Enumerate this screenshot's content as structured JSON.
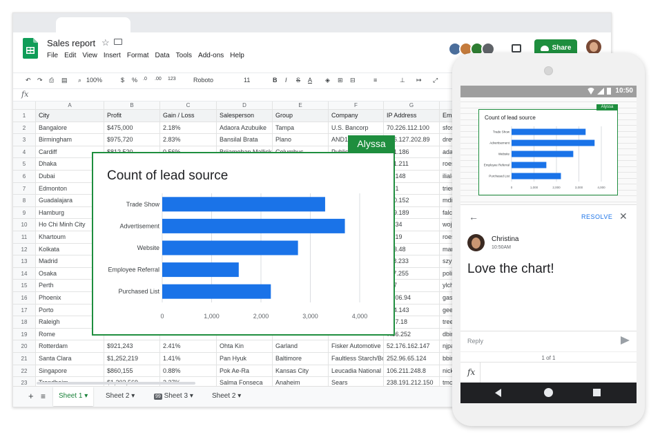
{
  "doc": {
    "title": "Sales report"
  },
  "menu": [
    "File",
    "Edit",
    "View",
    "Insert",
    "Format",
    "Data",
    "Tools",
    "Add-ons",
    "Help"
  ],
  "share_label": "Share",
  "toolbar": {
    "zoom": "100%",
    "currency": "$",
    "percent": "%",
    "decimals": ".0",
    "decimals2": ".00",
    "format": "123",
    "font": "Roboto",
    "font_size": "11",
    "bold": "B",
    "italic": "I",
    "strike": "S",
    "text_color": "A"
  },
  "fx": "fx",
  "columns": [
    "A",
    "B",
    "C",
    "D",
    "E",
    "F",
    "G",
    "H"
  ],
  "header_row": [
    "City",
    "Profit",
    "Gain / Loss",
    "Salesperson",
    "Group",
    "Company",
    "IP Address",
    "Email"
  ],
  "rows": [
    [
      "Bangalore",
      "$475,000",
      "2.18%",
      "Adaora Azubuike",
      "Tampa",
      "U.S. Bancorp",
      "70.226.112.100",
      "sfoskett@"
    ],
    [
      "Birmingham",
      "$975,720",
      "2.83%",
      "Bansilal Brata",
      "Plano",
      "AND1",
      "166.127.202.89",
      "drewf@"
    ],
    [
      "Cardiff",
      "$812,520",
      "0.56%",
      "Brijamohan Mallick",
      "Columbus",
      "Publishers",
      "101.186",
      "adamk@"
    ],
    [
      "Dhaka",
      "",
      "",
      "",
      "",
      "",
      "221.211",
      "roesch@"
    ],
    [
      "Dubai",
      "",
      "",
      "",
      "",
      "",
      "01.148",
      "ilial@ac"
    ],
    [
      "Edmonton",
      "",
      "",
      "",
      "",
      "",
      "82.1",
      "trieuvar"
    ],
    [
      "Guadalajara",
      "",
      "",
      "",
      "",
      "",
      "220.152",
      "mdielma"
    ],
    [
      "Hamburg",
      "",
      "",
      "",
      "",
      "",
      "139.189",
      "falcao@"
    ],
    [
      "Ho Chi Minh City",
      "",
      "",
      "",
      "",
      "",
      "8.134",
      "wojciech"
    ],
    [
      "Khartoum",
      "",
      "",
      "",
      "",
      "",
      "2.219",
      "roesch@"
    ],
    [
      "Kolkata",
      "",
      "",
      "",
      "",
      "",
      "123.48",
      "markjug"
    ],
    [
      "Madrid",
      "",
      "",
      "",
      "",
      "",
      "118.233",
      "szymans"
    ],
    [
      "Osaka",
      "",
      "",
      "",
      "",
      "",
      "117.255",
      "policies@"
    ],
    [
      "Perth",
      "",
      "",
      "",
      "",
      "",
      "237",
      "ylchang@"
    ],
    [
      "Phoenix",
      "",
      "",
      "",
      "",
      "",
      "2.206.94",
      "gastown"
    ],
    [
      "Porto",
      "",
      "",
      "",
      "",
      "",
      "194.143",
      "geekgrl@"
    ],
    [
      "Raleigh",
      "",
      "",
      "",
      "",
      "",
      "0.37.18",
      "treeves@"
    ],
    [
      "Rome",
      "",
      "",
      "",
      "",
      "",
      "7.86.252",
      "dbindel@"
    ],
    [
      "Rotterdam",
      "$921,243",
      "2.41%",
      "Ohta Kin",
      "Garland",
      "Fisker Automotive",
      "52.176.162.147",
      "njpayne@"
    ],
    [
      "Santa Clara",
      "$1,252,219",
      "1.41%",
      "Pan Hyuk",
      "Baltimore",
      "Faultless Starch/Bo",
      "252.96.65.124",
      "bbirth@"
    ],
    [
      "Singapore",
      "$860,155",
      "0.88%",
      "Pok Ae-Ra",
      "Kansas City",
      "Leucadia National",
      "106.211.248.8",
      "nicktrig@"
    ],
    [
      "Trondheim",
      "$1,202,569",
      "2.37%",
      "Salma Fonseca",
      "Anaheim",
      "Sears",
      "238.191.212.150",
      "tmccarth"
    ]
  ],
  "sheet_tabs": [
    "Sheet 1",
    "Sheet 2",
    "Sheet 3",
    "Sheet 2"
  ],
  "sheet_tab_badge": "99",
  "collaborator_tag": "Alyssa",
  "chart_data": {
    "type": "bar",
    "orientation": "horizontal",
    "title": "Count of lead source",
    "categories": [
      "Trade Show",
      "Advertisement",
      "Website",
      "Employee Referral",
      "Purchased List"
    ],
    "values": [
      3300,
      3700,
      2750,
      1550,
      2200
    ],
    "xlim": [
      0,
      4000
    ],
    "xticks": [
      "0",
      "1,000",
      "2,000",
      "3,000",
      "4,000"
    ],
    "color": "#1a73e8",
    "grid": true
  },
  "phone": {
    "clock": "10:50",
    "resolve_label": "RESOLVE",
    "commenter": "Christina",
    "comment_time": "10:50AM",
    "comment_text": "Love the chart!",
    "reply_placeholder": "Reply",
    "pager": "1 of 1",
    "fx": "fx",
    "mini_tag": "Alyssa",
    "mini_title": "Count of lead source"
  }
}
